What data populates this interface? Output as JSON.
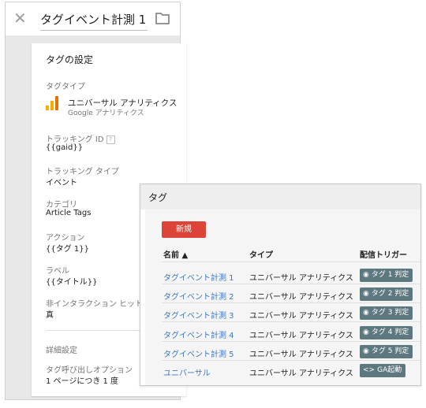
{
  "editor": {
    "title": "タグイベント計測 1",
    "card_title": "タグの設定",
    "fields": {
      "tag_type_label": "タグタイプ",
      "tag_type_name": "ユニバーサル アナリティクス",
      "tag_type_sub": "Google アナリティクス",
      "tracking_id_label": "トラッキング ID",
      "tracking_id_help": "?",
      "tracking_id_value": "{{gaid}}",
      "tracking_type_label": "トラッキング タイプ",
      "tracking_type_value": "イベント",
      "category_label": "カテゴリ",
      "category_value": "Article Tags",
      "action_label": "アクション",
      "action_value": "{{タグ 1}}",
      "label_label": "ラベル",
      "label_value": "{{タイトル}}",
      "noninteraction_label": "非インタラクション ヒット",
      "noninteraction_value": "真",
      "advanced_label": "詳細設定",
      "firing_option_label": "タグ呼び出しオプション",
      "firing_option_value": "1 ページにつき 1 度"
    }
  },
  "tags_list": {
    "title": "タグ",
    "new_button": "新規",
    "columns": {
      "name": "名前 ▲",
      "type": "タイプ",
      "trigger": "配信トリガー"
    },
    "rows": [
      {
        "name": "タグイベント計測 1",
        "type": "ユニバーサル アナリティクス",
        "trigger": "タグ 1 判定",
        "trigger_icon": "eye-icon"
      },
      {
        "name": "タグイベント計測 2",
        "type": "ユニバーサル アナリティクス",
        "trigger": "タグ 2 判定",
        "trigger_icon": "eye-icon"
      },
      {
        "name": "タグイベント計測 3",
        "type": "ユニバーサル アナリティクス",
        "trigger": "タグ 3 判定",
        "trigger_icon": "eye-icon"
      },
      {
        "name": "タグイベント計測 4",
        "type": "ユニバーサル アナリティクス",
        "trigger": "タグ 4 判定",
        "trigger_icon": "eye-icon"
      },
      {
        "name": "タグイベント計測 5",
        "type": "ユニバーサル アナリティクス",
        "trigger": "タグ 5 判定",
        "trigger_icon": "eye-icon"
      },
      {
        "name": "ユニバーサル",
        "type": "ユニバーサル アナリティクス",
        "trigger": "GA起動",
        "trigger_icon": "code-icon"
      }
    ]
  },
  "colors": {
    "new_button": "#db4437",
    "link": "#4078c0",
    "chip": "#5e7880",
    "ga_orange": "#f9ab00",
    "ga_dark": "#e37400"
  },
  "icons": {
    "close": "close-icon",
    "folder": "folder-icon",
    "analytics": "google-analytics-icon",
    "eye": "eye-icon",
    "code": "code-icon"
  }
}
